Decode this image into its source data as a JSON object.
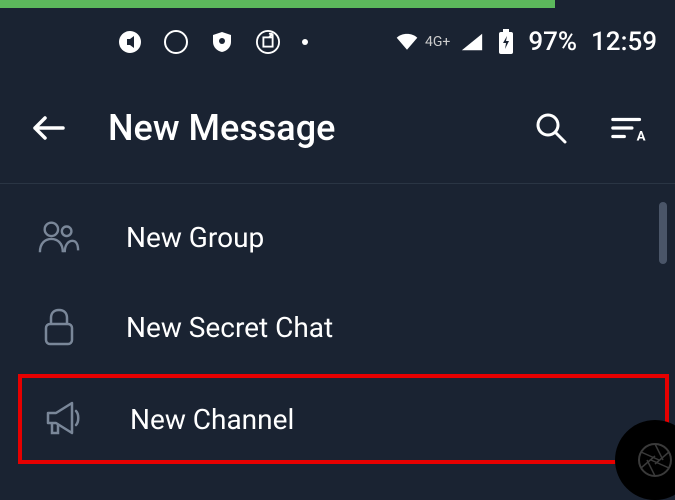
{
  "status_bar": {
    "network_label": "4G+",
    "battery_text": "97%",
    "time": "12:59"
  },
  "header": {
    "title": "New Message"
  },
  "list": {
    "items": [
      {
        "label": "New Group"
      },
      {
        "label": "New Secret Chat"
      },
      {
        "label": "New Channel"
      }
    ]
  }
}
